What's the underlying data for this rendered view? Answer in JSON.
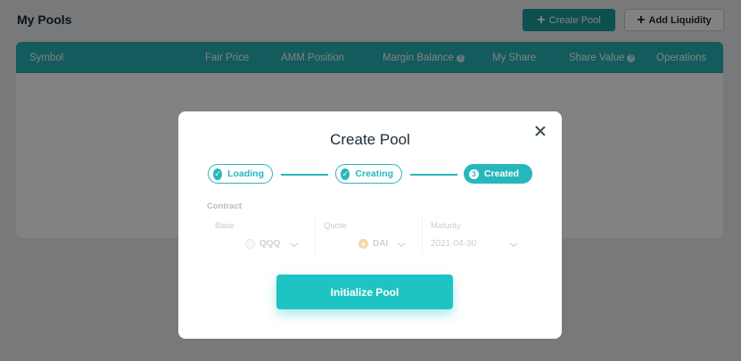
{
  "page": {
    "title": "My Pools",
    "create_pool_label": "Create Pool",
    "add_liquidity_label": "Add Liquidity"
  },
  "table": {
    "columns": [
      "Symbol",
      "Fair Price",
      "AMM Position",
      "Margin Balance",
      "My Share",
      "Share Value",
      "Operations"
    ]
  },
  "modal": {
    "title": "Create Pool",
    "steps": [
      {
        "label": "Loading",
        "status": "done"
      },
      {
        "label": "Creating",
        "status": "done"
      },
      {
        "label": "Created",
        "status": "current",
        "number": "3"
      }
    ],
    "contract_label": "Contract",
    "fields": {
      "base": {
        "label": "Base",
        "value": "QQQ"
      },
      "quote": {
        "label": "Quote",
        "value": "DAI"
      },
      "maturity": {
        "label": "Maturity",
        "value": "2021-04-30"
      }
    },
    "submit_label": "Initialize Pool"
  },
  "colors": {
    "accent": "#26b7bb",
    "header_bg": "#26b3b7",
    "button_dark": "#1d9c9c",
    "button_primary": "#1ec4c4"
  }
}
